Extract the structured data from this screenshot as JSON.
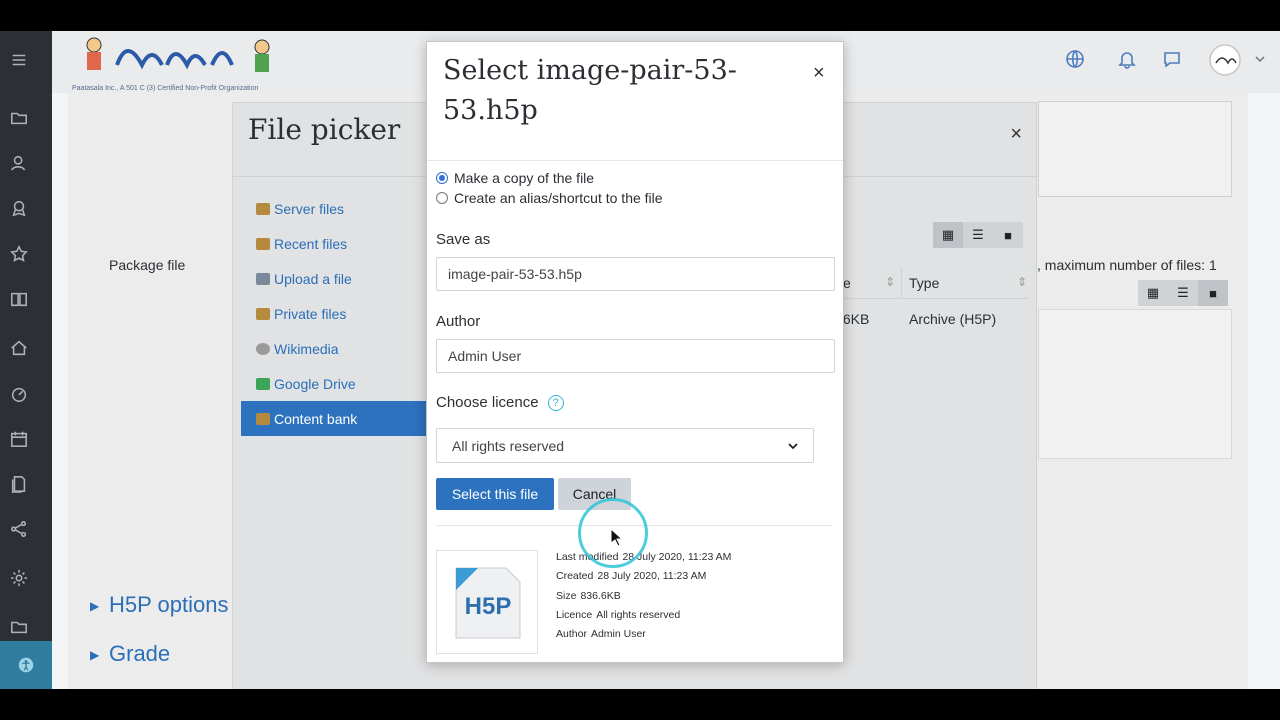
{
  "navbar": {
    "logo_caption": "Paatasala Inc., A 501 C (3) Certified Non-Profit Organization",
    "icons": [
      "globe-icon",
      "bell-icon",
      "chat-icon",
      "user-avatar"
    ]
  },
  "rail": {
    "icons": [
      "menu-icon",
      "folder-icon",
      "user-icon",
      "badge-icon",
      "star-icon",
      "book-icon",
      "home-icon",
      "dashboard-icon",
      "calendar-icon",
      "files-icon",
      "share-icon",
      "settings-icon",
      "folder-icon",
      "accessibility-icon"
    ]
  },
  "page": {
    "package_file_label": "Package file",
    "max_files_text": ", maximum number of files: 1",
    "h5p_options": "H5P options",
    "grade": "Grade"
  },
  "file_picker": {
    "title": "File picker",
    "close": "×",
    "sidebar": [
      {
        "label": "Server files",
        "active": false
      },
      {
        "label": "Recent files",
        "active": false
      },
      {
        "label": "Upload a file",
        "active": false
      },
      {
        "label": "Private files",
        "active": false
      },
      {
        "label": "Wikimedia",
        "active": false
      },
      {
        "label": "Google Drive",
        "active": false
      },
      {
        "label": "Content bank",
        "active": true
      }
    ],
    "table": {
      "col_size_partial": "e",
      "col_type": "Type",
      "row_size_partial": ".6KB",
      "row_type": "Archive (H5P)"
    }
  },
  "dialog": {
    "title": "Select image-pair-53-53.h5p",
    "close": "×",
    "options": {
      "copy": "Make a copy of the file",
      "alias": "Create an alias/shortcut to the file"
    },
    "save_as_label": "Save as",
    "save_as_value": "image-pair-53-53.h5p",
    "author_label": "Author",
    "author_value": "Admin User",
    "licence_label": "Choose licence",
    "licence_help": "?",
    "licence_value": "All rights reserved",
    "select_button": "Select this file",
    "cancel_button": "Cancel",
    "thumb_text": "H5P",
    "meta": {
      "last_modified_label": "Last modified",
      "last_modified_value": "28 July 2020, 11:23 AM",
      "created_label": "Created",
      "created_value": "28 July 2020, 11:23 AM",
      "size_label": "Size",
      "size_value": "836.6KB",
      "licence_label": "Licence",
      "licence_value": "All rights reserved",
      "author_label": "Author",
      "author_value": "Admin User"
    }
  },
  "colors": {
    "primary": "#2c72be",
    "link": "#2b6fb8",
    "rail": "#2c3035",
    "cursor_ring": "#2ec4d6"
  }
}
